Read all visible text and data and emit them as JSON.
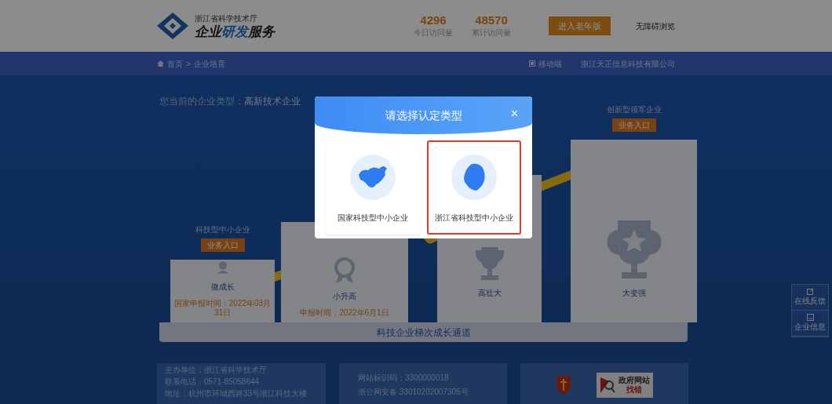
{
  "header": {
    "department": "浙江省科学技术厅",
    "logo_title": [
      {
        "text": "企业",
        "highlight": false
      },
      {
        "text": "研发",
        "highlight": true
      },
      {
        "text": "服务",
        "highlight": false
      }
    ],
    "stats": [
      {
        "value": "4296",
        "label": "今日访问量"
      },
      {
        "value": "48570",
        "label": "累计访问量"
      }
    ],
    "elder_button": "进入老年版",
    "accessibility_link": "无障碍浏览"
  },
  "nav": {
    "breadcrumb": [
      "首页",
      ">",
      "企业培育"
    ],
    "mobile": "移动端",
    "company": "浙江天正信息科技有限公司"
  },
  "current_type": {
    "label": "您当前的企业类型：",
    "value": "高新技术企业"
  },
  "stages": [
    {
      "title": "科技型中小企业",
      "entry_button": "业务入口",
      "name": "微成长",
      "note": "国家申报时间：2022年03月31日"
    },
    {
      "name": "小升高",
      "note": "申报时间：2022年6月1日"
    },
    {
      "name": "高壮大"
    },
    {
      "title": "创新型领军企业",
      "entry_button": "业务入口",
      "name": "大变强"
    }
  ],
  "growth_channel": "科技企业梯次成长通道",
  "side_tools": [
    {
      "label": "在线反馈"
    },
    {
      "label": "企业信息"
    }
  ],
  "footer": {
    "columns": [
      [
        "主办单位：浙江省科学技术厅",
        "联系电话：0571-85058644",
        "地址：杭州市环城西路33号浙江科技大楼"
      ],
      [
        "网站标识码：3300000018",
        "浙公网安备 33010202007305号"
      ]
    ],
    "badge": {
      "line1": "政府网站",
      "line2": "找错"
    }
  },
  "modal": {
    "title": "请选择认定类型",
    "close": "×",
    "options": [
      {
        "label": "国家科技型中小企业",
        "selected": false
      },
      {
        "label": "浙江省科技型中小企业",
        "selected": true
      }
    ]
  }
}
